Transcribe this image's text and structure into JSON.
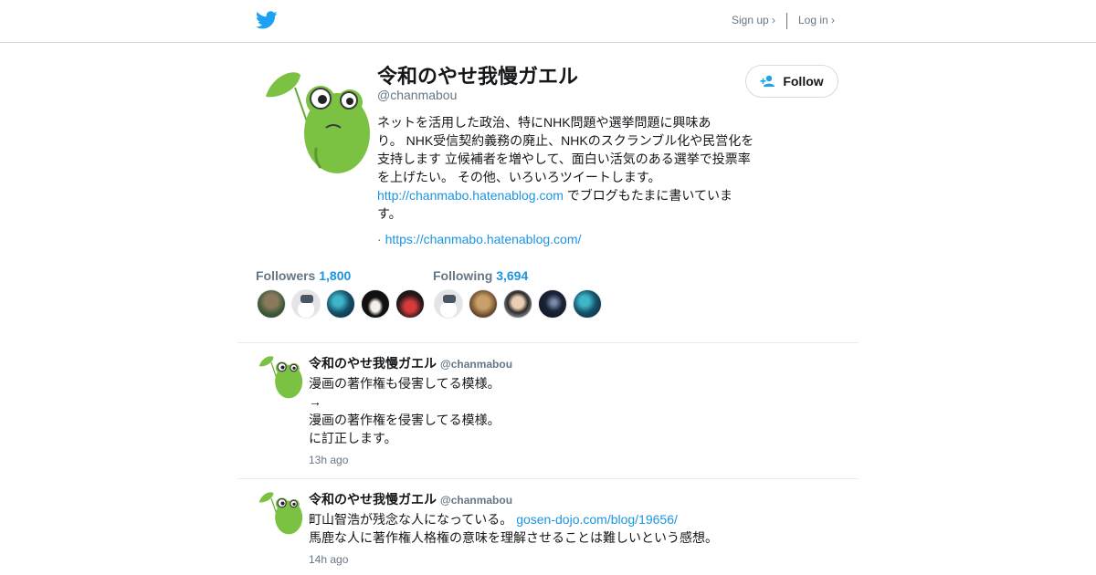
{
  "header": {
    "logo_icon": "twitter-bird-icon",
    "signup_label": "Sign up ›",
    "login_label": "Log in ›",
    "brand_color": "#1da1f2"
  },
  "profile": {
    "avatar_icon": "frog-avatar",
    "name": "令和のやせ我慢ガエル",
    "handle": "@chanmabou",
    "bio_lines": [
      "ネットを活用した政治、特にNHK問題や選挙問題に興味あ",
      "り。 NHK受信契約義務の廃止、NHKのスクランブル化や民営化を",
      "支持します 立候補者を増やして、面白い活気のある選挙で投票率",
      "を上げたい。 その他、いろいろツイートします。"
    ],
    "bio_link": "http://chanmabo.hatenablog.com",
    "bio_after_link": " でブログもたまに書いていま",
    "bio_last": "す。",
    "url_prefix": "· ",
    "url": "https://chanmabo.hatenablog.com/",
    "follow_label": "Follow",
    "follow_icon": "add-user-icon"
  },
  "stats": {
    "followers_label": "Followers",
    "followers_count": "1,800",
    "following_label": "Following",
    "following_count": "3,694"
  },
  "tweets": [
    {
      "name": "令和のやせ我慢ガエル",
      "handle": "@chanmabou",
      "lines": [
        "漫画の著作権も侵害してる模様。",
        "→",
        "漫画の著作権を侵害してる模様。",
        "に訂正します。"
      ],
      "time": "13h ago"
    },
    {
      "name": "令和のやせ我慢ガエル",
      "handle": "@chanmabou",
      "line1": "町山智浩が残念な人になっている。 ",
      "link": "gosen-dojo.com/blog/19656/",
      "line2": "馬鹿な人に著作権人格権の意味を理解させることは難しいという感想。",
      "time": "14h ago"
    }
  ],
  "colors": {
    "accent": "#1b95e0",
    "muted": "#657786",
    "frog_green": "#7bc142"
  }
}
